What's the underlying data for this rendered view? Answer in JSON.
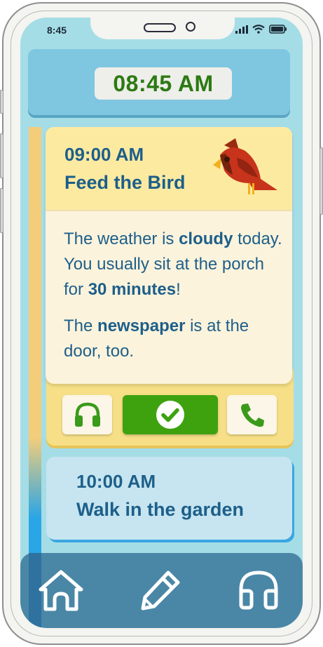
{
  "status_bar": {
    "time": "8:45",
    "icons": [
      "signal-icon",
      "wifi-icon",
      "battery-icon"
    ]
  },
  "header": {
    "clock": "08:45 AM"
  },
  "active_task": {
    "time": "09:00 AM",
    "title": "Feed the Bird",
    "illustration": "cardinal-bird-icon",
    "body": {
      "p1_text1": "The weather is ",
      "p1_bold1": "cloudy",
      "p1_text2": " today. You usually sit at the porch for ",
      "p1_bold2": "30 minutes",
      "p1_text3": "!",
      "p2_text1": "The ",
      "p2_bold1": "newspaper",
      "p2_text2": " is at the door, too."
    },
    "actions": [
      {
        "name": "listen",
        "icon": "headphones-icon"
      },
      {
        "name": "done",
        "icon": "check-circle-icon"
      },
      {
        "name": "call",
        "icon": "phone-icon"
      }
    ]
  },
  "next_task": {
    "time": "10:00 AM",
    "title": "Walk in the garden"
  },
  "bottom_nav": {
    "items": [
      "home-icon",
      "pencil-icon",
      "headphones-icon"
    ]
  },
  "colors": {
    "screen_bg": "#a5dde6",
    "accent_blue": "#1d5f8a",
    "clock_green": "#2b7a12",
    "done_green": "#3ea20f",
    "active_card_header": "#fdeaa1",
    "next_card_bg": "#c6e5f0",
    "nav_bg": "#4a87a6"
  }
}
